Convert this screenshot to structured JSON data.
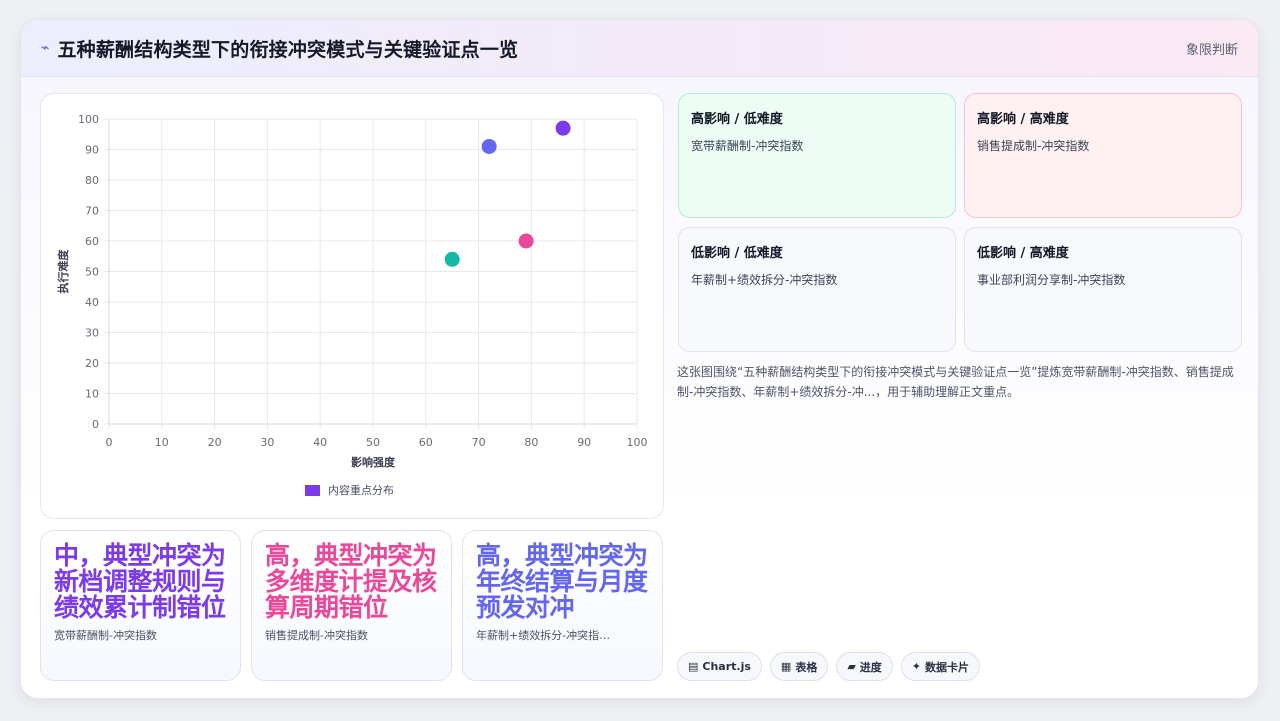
{
  "header": {
    "icon": "lightning-icon",
    "title": "五种薪酬结构类型下的衔接冲突模式与关键验证点一览",
    "right_label": "象限判断"
  },
  "chart_data": {
    "type": "scatter",
    "xlabel": "影响强度",
    "ylabel": "执行难度",
    "xlim": [
      0,
      100
    ],
    "ylim": [
      0,
      100
    ],
    "xticks": [
      "0",
      "10",
      "20",
      "30",
      "40",
      "50",
      "60",
      "70",
      "80",
      "90",
      "100"
    ],
    "yticks": [
      "0",
      "10",
      "20",
      "30",
      "40",
      "50",
      "60",
      "70",
      "80",
      "90",
      "100"
    ],
    "grid": true,
    "legend": {
      "label": "内容重点分布",
      "color": "#7c3aed",
      "position": "bottom"
    },
    "points": [
      {
        "x": 72,
        "y": 91,
        "color": "#6366f1"
      },
      {
        "x": 86,
        "y": 97,
        "color": "#7c3aed"
      },
      {
        "x": 79,
        "y": 60,
        "color": "#ec4899"
      },
      {
        "x": 65,
        "y": 54,
        "color": "#14b8a6"
      }
    ]
  },
  "stats": [
    {
      "text": "中，典型冲突为新档调整规则与绩效累计制错位",
      "sub": "宽带薪酬制-冲突指数",
      "color": "#7c3aed"
    },
    {
      "text": "高，典型冲突为多维度计提及核算周期错位",
      "sub": "销售提成制-冲突指数",
      "color": "#ec4899"
    },
    {
      "text": "高，典型冲突为年终结算与月度预发对冲",
      "sub": "年薪制+绩效拆分-冲突指…",
      "color": "#6366f1"
    }
  ],
  "quadrants": [
    {
      "title": "高影响 / 低难度",
      "item": "宽带薪酬制-冲突指数",
      "bg": "#ecfdf5",
      "border": "#b7ebd3"
    },
    {
      "title": "高影响 / 高难度",
      "item": "销售提成制-冲突指数",
      "bg": "#fff1f2",
      "border": "#f6c4cf"
    },
    {
      "title": "低影响 / 低难度",
      "item": "年薪制+绩效拆分-冲突指数",
      "bg": "#f7f9fd",
      "border": "#dfe3ef"
    },
    {
      "title": "低影响 / 高难度",
      "item": "事业部利润分享制-冲突指数",
      "bg": "#f7f9fd",
      "border": "#dfe3ef"
    }
  ],
  "description": "这张图围绕“五种薪酬结构类型下的衔接冲突模式与关键验证点一览”提炼宽带薪酬制-冲突指数、销售提成制-冲突指数、年薪制+绩效拆分-冲...，用于辅助理解正文重点。",
  "tags": [
    {
      "icon": "chart-icon",
      "glyph": "▤",
      "label": "Chart.js"
    },
    {
      "icon": "table-icon",
      "glyph": "▦",
      "label": "表格"
    },
    {
      "icon": "progress-icon",
      "glyph": "▰",
      "label": "进度"
    },
    {
      "icon": "sparkle-icon",
      "glyph": "✦",
      "label": "数据卡片"
    }
  ]
}
